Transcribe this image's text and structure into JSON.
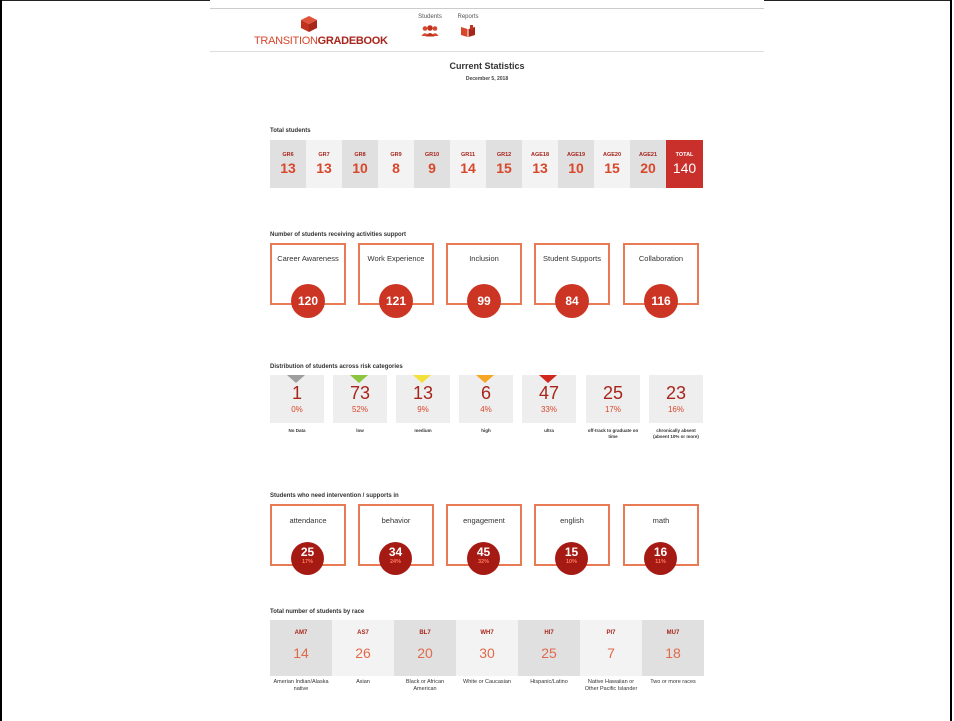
{
  "brand": {
    "part1": "TRANSITION",
    "part2": "GRADEBOOK"
  },
  "nav": {
    "students_label": "Students",
    "reports_label": "Reports"
  },
  "page": {
    "title": "Current Statistics",
    "date": "December 5, 2018"
  },
  "sections": {
    "total_students": "Total students",
    "activities": "Number of students receiving activities support",
    "risk": "Distribution of students across risk categories",
    "intervention": "Students who need intervention / supports in",
    "race": "Total number of students by race"
  },
  "grades": [
    {
      "label": "GR6",
      "value": "13"
    },
    {
      "label": "GR7",
      "value": "13"
    },
    {
      "label": "GR8",
      "value": "10"
    },
    {
      "label": "GR9",
      "value": "8"
    },
    {
      "label": "GR10",
      "value": "9"
    },
    {
      "label": "GR11",
      "value": "14"
    },
    {
      "label": "GR12",
      "value": "15"
    },
    {
      "label": "AGE18",
      "value": "13"
    },
    {
      "label": "AGE19",
      "value": "10"
    },
    {
      "label": "AGE20",
      "value": "15"
    },
    {
      "label": "AGE21",
      "value": "20"
    },
    {
      "label": "TOTAL",
      "value": "140"
    }
  ],
  "activities": [
    {
      "name": "Career Awareness",
      "value": "120"
    },
    {
      "name": "Work Experience",
      "value": "121"
    },
    {
      "name": "Inclusion",
      "value": "99"
    },
    {
      "name": "Student Supports",
      "value": "84"
    },
    {
      "name": "Collaboration",
      "value": "116"
    }
  ],
  "risk": [
    {
      "value": "1",
      "pct": "0%",
      "label": "No Data",
      "color": "#9e9e9e"
    },
    {
      "value": "73",
      "pct": "52%",
      "label": "low",
      "color": "#8cc63f"
    },
    {
      "value": "13",
      "pct": "9%",
      "label": "medium",
      "color": "#f2e13b"
    },
    {
      "value": "6",
      "pct": "4%",
      "label": "high",
      "color": "#f5a623"
    },
    {
      "value": "47",
      "pct": "33%",
      "label": "ultra",
      "color": "#d0281c"
    },
    {
      "value": "25",
      "pct": "17%",
      "label": "off-track to graduate on time",
      "color": ""
    },
    {
      "value": "23",
      "pct": "16%",
      "label": "chronically absent (absent 10% or more)",
      "color": ""
    }
  ],
  "intervention": [
    {
      "name": "attendance",
      "value": "25",
      "pct": "17%"
    },
    {
      "name": "behavior",
      "value": "34",
      "pct": "24%"
    },
    {
      "name": "engagement",
      "value": "45",
      "pct": "32%"
    },
    {
      "name": "english",
      "value": "15",
      "pct": "10%"
    },
    {
      "name": "math",
      "value": "16",
      "pct": "11%"
    }
  ],
  "race": [
    {
      "code": "AM7",
      "value": "14",
      "desc": "Amerian Indian/Alaska native"
    },
    {
      "code": "AS7",
      "value": "26",
      "desc": "Asian"
    },
    {
      "code": "BL7",
      "value": "20",
      "desc": "Black or African American"
    },
    {
      "code": "WH7",
      "value": "30",
      "desc": "White or Caucasian"
    },
    {
      "code": "HI7",
      "value": "25",
      "desc": "Hispanic/Latino"
    },
    {
      "code": "PI7",
      "value": "7",
      "desc": "Native Hawaiian or Other Pacific Islander"
    },
    {
      "code": "MU7",
      "value": "18",
      "desc": "Two or more races"
    }
  ],
  "icons": {
    "logo": "cube-logo-icon",
    "students": "students-icon",
    "reports": "reports-icon"
  },
  "colors": {
    "accent": "#d9472b",
    "dark_red": "#a7251b",
    "badge_red": "#cc3524",
    "badge_dark": "#a61a14"
  }
}
